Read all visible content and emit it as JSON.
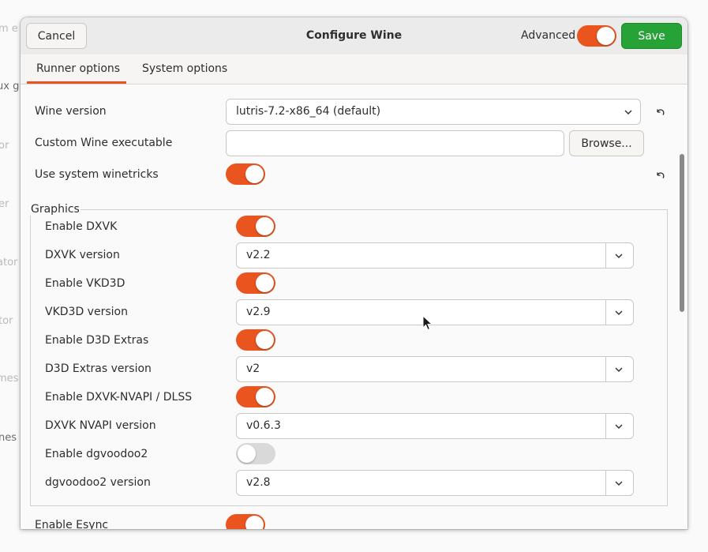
{
  "background_fragments": [
    "m e",
    "ux g",
    "or",
    "er",
    "ator",
    "tor",
    "mes",
    "nes"
  ],
  "dialog": {
    "title": "Configure Wine",
    "cancel_label": "Cancel",
    "save_label": "Save",
    "advanced_label": "Advanced",
    "advanced_on": true
  },
  "tabs": [
    {
      "label": "Runner options",
      "active": true
    },
    {
      "label": "System options",
      "active": false
    }
  ],
  "runner": {
    "wine_version_label": "Wine version",
    "wine_version_value": "lutris-7.2-x86_64 (default)",
    "custom_exec_label": "Custom Wine executable",
    "custom_exec_value": "",
    "browse_label": "Browse...",
    "system_winetricks_label": "Use system winetricks",
    "system_winetricks_on": true
  },
  "graphics": {
    "title": "Graphics",
    "rows": [
      {
        "label": "Enable DXVK",
        "kind": "toggle",
        "on": true
      },
      {
        "label": "DXVK version",
        "kind": "select",
        "value": "v2.2"
      },
      {
        "label": "Enable VKD3D",
        "kind": "toggle",
        "on": true
      },
      {
        "label": "VKD3D version",
        "kind": "select",
        "value": "v2.9"
      },
      {
        "label": "Enable D3D Extras",
        "kind": "toggle",
        "on": true
      },
      {
        "label": "D3D Extras version",
        "kind": "select",
        "value": "v2"
      },
      {
        "label": "Enable DXVK-NVAPI / DLSS",
        "kind": "toggle",
        "on": true
      },
      {
        "label": "DXVK NVAPI version",
        "kind": "select",
        "value": "v0.6.3"
      },
      {
        "label": "Enable dgvoodoo2",
        "kind": "toggle",
        "on": false
      },
      {
        "label": "dgvoodoo2 version",
        "kind": "select",
        "value": "v2.8"
      }
    ]
  },
  "esync": {
    "label": "Enable Esync",
    "on": true
  },
  "colors": {
    "accent": "#e9541f",
    "save": "#26a236",
    "toggle_off": "#d9d9d9"
  }
}
